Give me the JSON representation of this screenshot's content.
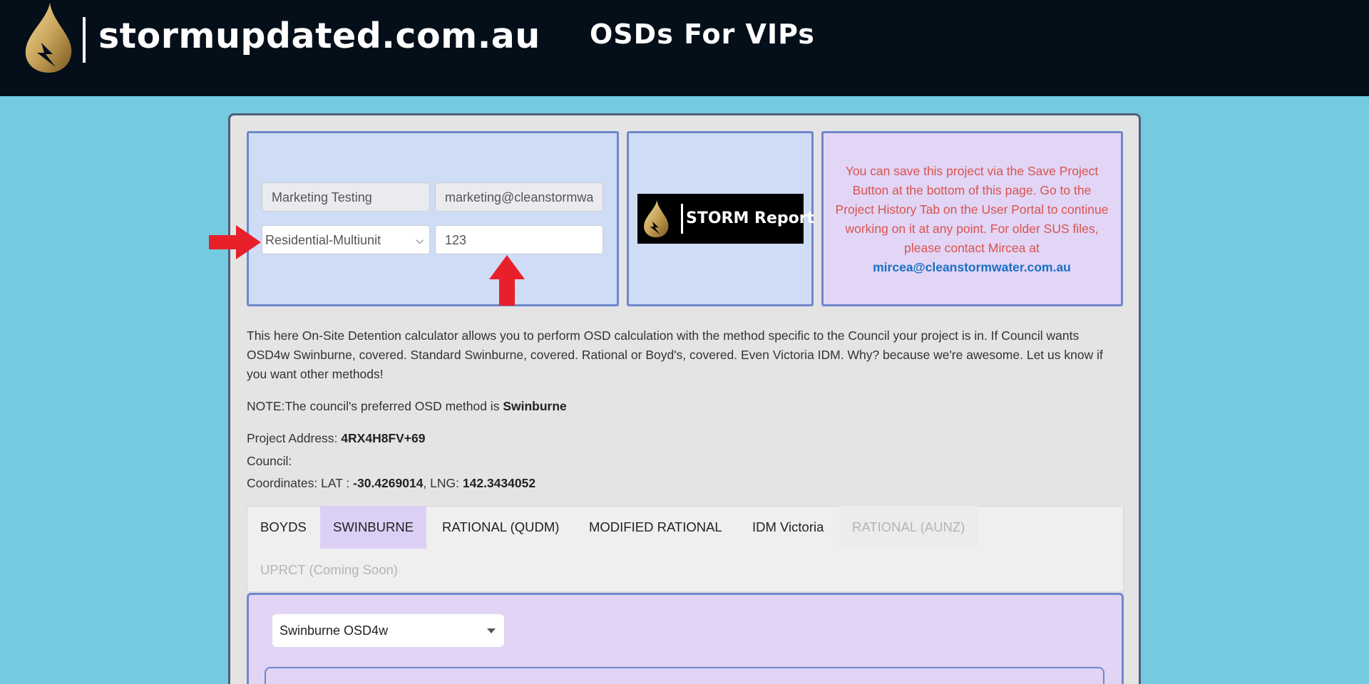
{
  "header": {
    "site_name": "stormupdated.com.au",
    "page_heading": "OSDs For VIPs",
    "logo_icon": "gold-droplet-lightning-logo",
    "colors": {
      "background": "#050f1a",
      "text": "#ffffff",
      "logo_gold": "#c9a45a"
    }
  },
  "project_form": {
    "name_value": "Marketing Testing",
    "email_value": "marketing@cleanstormwa",
    "development_type": "Residential-Multiunit",
    "number_value": "123"
  },
  "storm_report_logo": {
    "text": "STORM Report"
  },
  "info_box": {
    "message": "You can save this project via the Save Project Button at the bottom of this page. Go to the Project History Tab on the User Portal to continue working on it at any point. For older SUS files, please contact Mircea at",
    "email": "mircea@cleanstormwater.com.au",
    "text_color": "#d9534f"
  },
  "description": "This here On-Site Detention calculator allows you to perform OSD calculation with the method specific to the Council your project is in. If Council wants OSD4w Swinburne, covered. Standard Swinburne, covered. Rational or Boyd's, covered. Even Victoria IDM. Why? because we're awesome. Let us know if you want other methods!",
  "note": {
    "prefix": "NOTE:The council's preferred OSD method is ",
    "method": "Swinburne"
  },
  "project_details": {
    "address_label": "Project Address: ",
    "address_value": "4RX4H8FV+69",
    "council_label": "Council:",
    "coords_label": "Coordinates: LAT : ",
    "lat_value": "-30.4269014",
    "lng_label": ", LNG: ",
    "lng_value": "142.3434052"
  },
  "tabs": [
    {
      "label": "BOYDS",
      "state": "normal"
    },
    {
      "label": "SWINBURNE",
      "state": "active"
    },
    {
      "label": "RATIONAL (QUDM)",
      "state": "normal"
    },
    {
      "label": "MODIFIED RATIONAL",
      "state": "normal"
    },
    {
      "label": "IDM Victoria",
      "state": "normal"
    },
    {
      "label": "RATIONAL (AUNZ)",
      "state": "disabled"
    },
    {
      "label": "UPRCT (Coming Soon)",
      "state": "disabled"
    }
  ],
  "method_selector": {
    "selected": "Swinburne OSD4w"
  },
  "annotations": {
    "arrow_color": "#e8202a"
  }
}
